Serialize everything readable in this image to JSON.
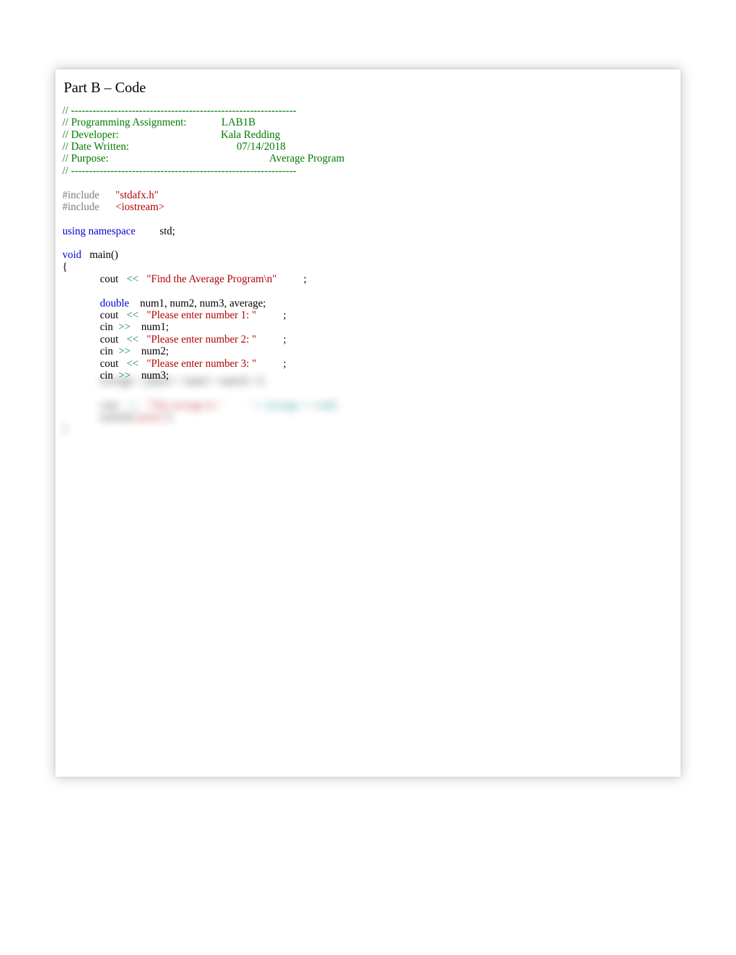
{
  "heading": "Part B – Code",
  "code": {
    "divider": "// ---------------------------------------------------------------",
    "hc1a": "// Programming Assignment:",
    "hc1b": "LAB1B",
    "hc2a": "// Developer:",
    "hc2b": "Kala Redding",
    "hc3a": "// Date Written:",
    "hc3b": "07/14/2018",
    "hc4a": "// Purpose:",
    "hc4b": "Average Program",
    "inc_kw": "#include",
    "inc1": "\"stdafx.h\"",
    "inc2": "<iostream>",
    "using_kw": "using",
    "namespace_kw": "namespace",
    "std": "std;",
    "void_kw": "void",
    "main_sig": "main()",
    "lbrace": "{",
    "cout": "cout",
    "lshift": "<<",
    "str1": "\"Find the Average Program\\n\"",
    "semi": ";",
    "double_kw": "double",
    "decl_vars": "num1, num2, num3, average;",
    "str2": "\"Please enter number 1: \"",
    "cin": "cin",
    "rshift": ">>",
    "num1": "num1;",
    "str3": "\"Please enter number 2: \"",
    "num2": "num2;",
    "str4": "\"Please enter number 3: \"",
    "num3": "num3;",
    "avg_line": "average = (num1 + num2 + num3) / 3;",
    "str5": "\"The average is: \"",
    "avg_out": "<< average << endl;",
    "sys": "system(",
    "pause": "\"pause\"",
    "sysend": ");",
    "rbrace": "}"
  }
}
